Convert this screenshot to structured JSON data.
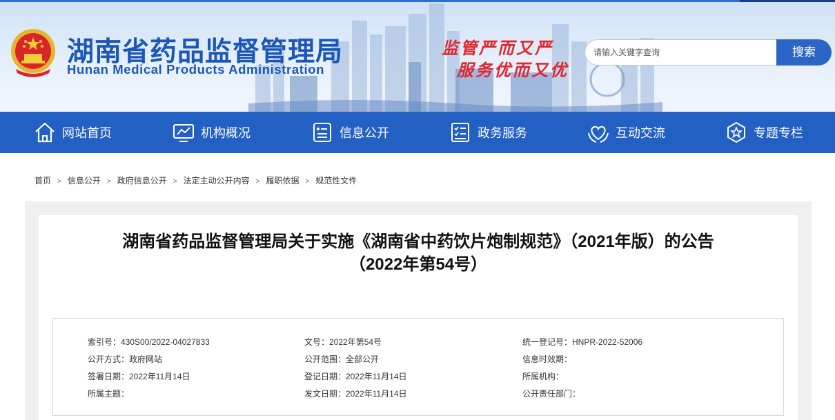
{
  "header": {
    "logo_cn": "湖南省药品监督管理局",
    "logo_en": "Hunan Medical Products Administration",
    "slogan_line1": "监管严而又严",
    "slogan_line2": "服务优而又优",
    "search_placeholder": "请输入关键字查询",
    "search_button": "搜索"
  },
  "nav": {
    "items": [
      {
        "label": "网站首页",
        "icon": "home-icon"
      },
      {
        "label": "机构概况",
        "icon": "chart-monitor-icon"
      },
      {
        "label": "信息公开",
        "icon": "info-list-icon"
      },
      {
        "label": "政务服务",
        "icon": "checklist-icon"
      },
      {
        "label": "互动交流",
        "icon": "heart-hands-icon"
      },
      {
        "label": "专题专栏",
        "icon": "star-badge-icon"
      }
    ]
  },
  "breadcrumb": [
    "首页",
    "信息公开",
    "政府信息公开",
    "法定主动公开内容",
    "履职依据",
    "规范性文件"
  ],
  "article": {
    "title_line1": "湖南省药品监督管理局关于实施《湖南省中药饮片炮制规范》（2021年版）的公告",
    "title_line2": "（2022年第54号）"
  },
  "meta": {
    "col1": [
      "索引号：430S00/2022-04027833",
      "公开方式：政府网站",
      "签署日期：2022年11月14日",
      "所属主题："
    ],
    "col2": [
      "文号：2022年第54号",
      "公开范围：全部公开",
      "登记日期：2022年11月14日",
      "发文日期：2022年11月14日"
    ],
    "col3": [
      "统一登记号：HNPR-2022-52006",
      "信息时效期：",
      "所属机构：",
      "公开责任部门："
    ]
  },
  "colors": {
    "brand_blue": "#1b57b8",
    "nav_blue": "#2360c4",
    "slogan_red": "#e0262f"
  }
}
